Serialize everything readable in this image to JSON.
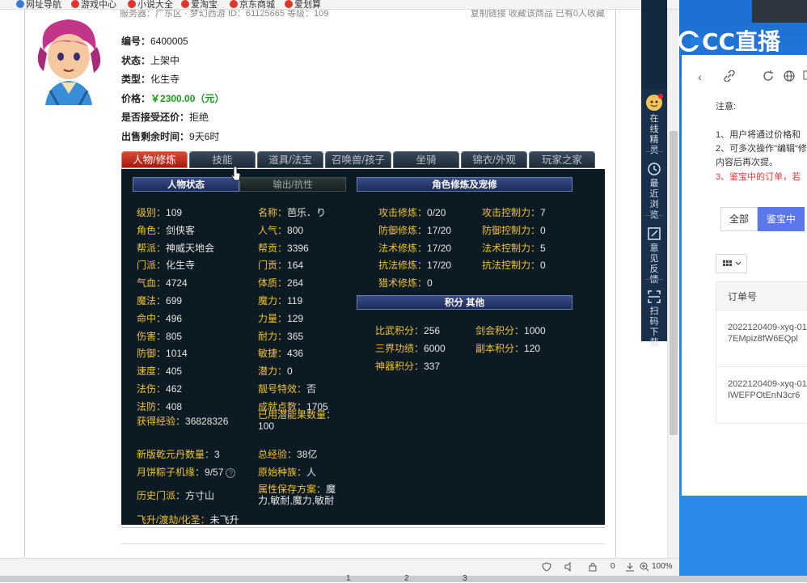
{
  "bookmarks": [
    {
      "label": "网址导航",
      "color": "#3a7bd5"
    },
    {
      "label": "游戏中心",
      "color": "#e0352b"
    },
    {
      "label": "小说大全",
      "color": "#e0352b"
    },
    {
      "label": "爱淘宝",
      "color": "#e0352b"
    },
    {
      "label": "京东商城",
      "color": "#e0352b"
    },
    {
      "label": "爱划算",
      "color": "#e0352b"
    }
  ],
  "top_strip": {
    "hint": "服务器：广东区 · 梦幻西游    ID：61125665    等级：109",
    "links": "复制链接   收藏该商品   已有0人收藏"
  },
  "item": {
    "number_label": "编号：",
    "number": "6400005",
    "status_label": "状态：",
    "status": "上架中",
    "type_label": "类型：",
    "type": "化生寺",
    "price_label": "价格：",
    "price": "￥2300.00（元）",
    "counter_label": "是否接受还价：",
    "counter": "拒绝",
    "remaining_label": "出售剩余时间：",
    "remaining": "9天6时"
  },
  "tabs": [
    "人物/修炼",
    "技能",
    "道具/法宝",
    "召唤兽/孩子",
    "坐骑",
    "锦衣/外观",
    "玩家之家"
  ],
  "panel": {
    "hdr_status": "人物状态",
    "hdr_output": "输出/抗性",
    "hdr_cultivation": "角色修炼及宠修",
    "hdr_points": "积分 其他",
    "col1": [
      {
        "label": "级别：",
        "value": "109"
      },
      {
        "label": "角色：",
        "value": "剑侠客"
      },
      {
        "label": "帮派：",
        "value": "神威天地会"
      },
      {
        "label": "门派：",
        "value": "化生寺"
      },
      {
        "label": "气血：",
        "value": "4724"
      },
      {
        "label": "魔法：",
        "value": "699"
      },
      {
        "label": "命中：",
        "value": "496"
      },
      {
        "label": "伤害：",
        "value": "805"
      },
      {
        "label": "防御：",
        "value": "1014"
      },
      {
        "label": "速度：",
        "value": "405"
      },
      {
        "label": "法伤：",
        "value": "462"
      },
      {
        "label": "法防：",
        "value": "408"
      }
    ],
    "col2": [
      {
        "label": "名称：",
        "value": "芭乐．り"
      },
      {
        "label": "人气：",
        "value": "800"
      },
      {
        "label": "帮贡：",
        "value": "3396"
      },
      {
        "label": "门贡：",
        "value": "164"
      },
      {
        "label": "体质：",
        "value": "264"
      },
      {
        "label": "魔力：",
        "value": "119"
      },
      {
        "label": "力量：",
        "value": "129"
      },
      {
        "label": "耐力：",
        "value": "365"
      },
      {
        "label": "敏捷：",
        "value": "436"
      },
      {
        "label": "潜力：",
        "value": "0"
      },
      {
        "label": "靓号特效：",
        "value": "否"
      },
      {
        "label": "成就点数：",
        "value": "1705"
      }
    ],
    "exp_label": "获得经验：",
    "exp": "36828326",
    "potential_label": "已用潜能果数量：",
    "potential": "100",
    "pill_label": "新版乾元丹数量：",
    "pill": "3",
    "total_exp_label": "总经验：",
    "total_exp": "38亿",
    "mooncake_label": "月饼粽子机缘：",
    "mooncake": "9/57",
    "race_label": "原始种族：",
    "race": "人",
    "history_label": "历史门派：",
    "history": "方寸山",
    "attr_label": "属性保存方案：",
    "attr": "魔力,敏耐,魔力,敏耐",
    "ascend_label": "飞升/渡劫/化圣：",
    "ascend": "未飞升",
    "cultivation": [
      {
        "label": "攻击修炼：",
        "value": "0/20",
        "label2": "攻击控制力：",
        "value2": "7"
      },
      {
        "label": "防御修炼：",
        "value": "17/20",
        "label2": "防御控制力：",
        "value2": "0"
      },
      {
        "label": "法术修炼：",
        "value": "17/20",
        "label2": "法术控制力：",
        "value2": "5"
      },
      {
        "label": "抗法修炼：",
        "value": "17/20",
        "label2": "抗法控制力：",
        "value2": "0"
      },
      {
        "label": "猎术修炼：",
        "value": "0"
      }
    ],
    "points": [
      {
        "label": "比武积分：",
        "value": "256",
        "label2": "剑会积分：",
        "value2": "1000"
      },
      {
        "label": "三界功绩：",
        "value": "6000",
        "label2": "副本积分：",
        "value2": "120"
      },
      {
        "label": "神器积分：",
        "value": "337"
      }
    ]
  },
  "toolbar": [
    {
      "label": "在线精灵"
    },
    {
      "label": "最近浏览"
    },
    {
      "label": "意见反馈"
    },
    {
      "label": "扫码下载"
    }
  ],
  "statusbar": {
    "zoom": "100%",
    "count": "0"
  },
  "below": [
    "1",
    "2",
    "3"
  ],
  "cc_logo": "CC直播",
  "right_panel": {
    "notice_title": "注意:",
    "lines": [
      "1、用户将通过价格和",
      "2、可多次操作\"编辑\"修",
      "内容后再次提。",
      "3、鉴宝中的订单，若"
    ],
    "tab_all": "全部",
    "tab_active": "鉴宝中",
    "col_header": "订单号",
    "orders": [
      "2022120409-xyq-01-7EMpiz8fW6EQpl",
      "2022120409-xyq-01-IWEFPOtEnN3cr6"
    ]
  },
  "colors": {
    "panel_bg": "#0c1a24",
    "label": "#f0c232",
    "tab_active": "#c0281a",
    "accent_blue": "#5a78ea"
  }
}
